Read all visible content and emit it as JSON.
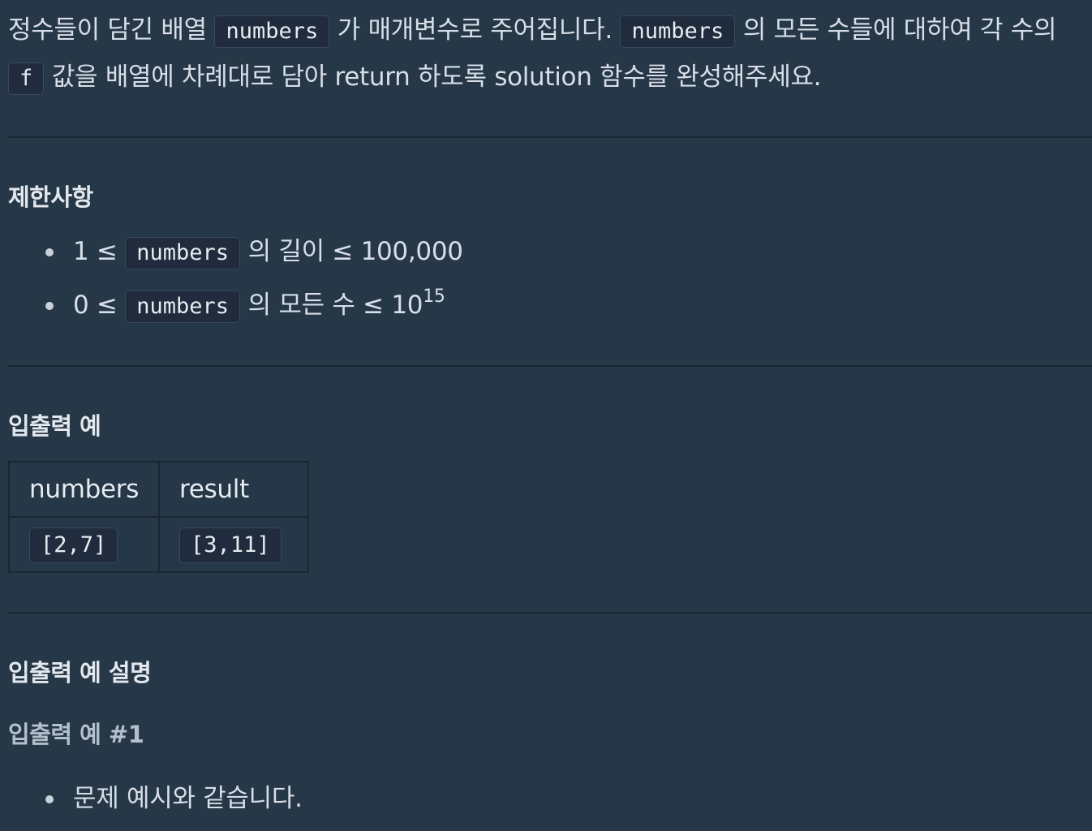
{
  "description": {
    "p1": "정수들이 담긴 배열",
    "code_numbers": "numbers",
    "p2": "가 매개변수로 주어집니다.",
    "p3": "의 모든 수들에 대하여 각 수의",
    "code_f": "f",
    "p4": "값을 배열에 차례대로 담아 return 하도록 solution 함수를 완성해주세요."
  },
  "constraints": {
    "title": "제한사항",
    "items": [
      {
        "prefix": "1 ≤",
        "code": "numbers",
        "suffix": "의 길이 ≤ 100,000"
      },
      {
        "prefix": "0 ≤",
        "code": "numbers",
        "suffix": "의 모든 수 ≤ 10",
        "exponent": "15"
      }
    ]
  },
  "examples": {
    "title": "입출력 예",
    "headers": [
      "numbers",
      "result"
    ],
    "rows": [
      [
        "[2,7]",
        "[3,11]"
      ]
    ]
  },
  "explanation": {
    "title": "입출력 예 설명",
    "example1_title": "입출력 예 #1",
    "items": [
      "문제 예시와 같습니다."
    ]
  }
}
